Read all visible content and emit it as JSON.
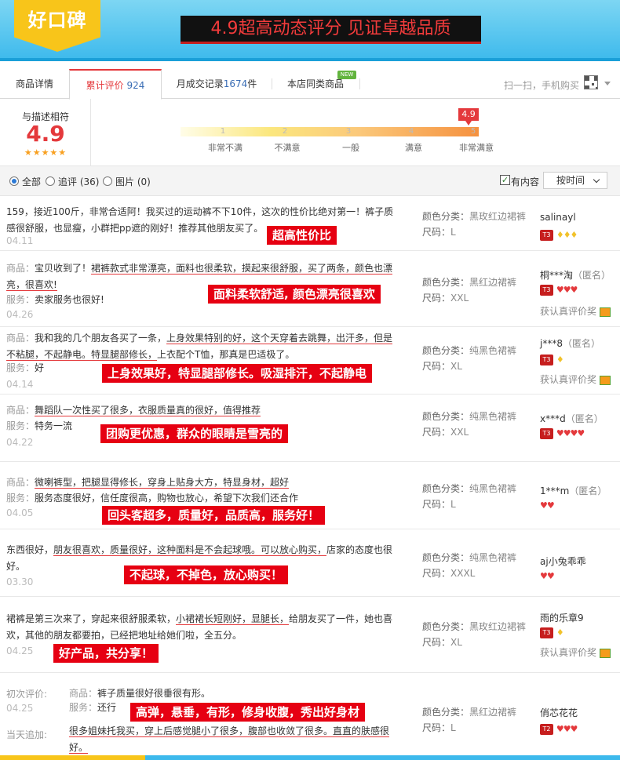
{
  "banner": {
    "logo": "好口碑",
    "slogan": "4.9超高动态评分  见证卓越品质"
  },
  "tabs": [
    {
      "label": "商品详情",
      "num": ""
    },
    {
      "label": "累计评价 ",
      "num": "924"
    },
    {
      "label": "月成交记录",
      "num": "1674",
      "suffix": "件"
    },
    {
      "label": "本店同类商品",
      "num": ""
    }
  ],
  "new_badge": "NEW",
  "scan_text": "扫一扫，手机购买",
  "rating": {
    "caption": "与描述相符",
    "score": "4.9",
    "stars": "★★★★★",
    "pointer": "4.9",
    "scale": [
      "1",
      "2",
      "3",
      "4",
      "5"
    ],
    "labels": [
      "非常不满",
      "不满意",
      "一般",
      "满意",
      "非常满意"
    ]
  },
  "filters": {
    "all": "全部",
    "followup": "追评 (36)",
    "photos": "图片 (0)",
    "has_content": "有内容",
    "sort": "按时间"
  },
  "reviews": [
    {
      "text_a": "159，接近100斤，非常合适阿！我买过的运动裤不下10件，这次的性价比绝对第一！裤子质感很舒服，也显瘦，小群把pp遮的刚好！推荐其他朋友买了。",
      "date": "04.11",
      "tag": "超高性价比",
      "color_label": "颜色分类：",
      "color": "黑玫红边裙裤",
      "size_label": "尺码：",
      "size": "L",
      "user": "salinayl",
      "level": "T3",
      "reward": ""
    },
    {
      "prefix": "商品：",
      "text_a": "宝贝收到了！",
      "text_u": "裙裤款式非常漂亮，面料也很柔软，摸起来很舒服，买了两条，颜色也漂亮，很喜欢!",
      "service_label": "服务：",
      "service": "卖家服务也很好!",
      "date": "04.26",
      "tag": "面料柔软舒适, 颜色漂亮很喜欢",
      "color_label": "颜色分类：",
      "color": "黑红边裙裤",
      "size_label": "尺码：",
      "size": "XXL",
      "user": "桐***淘",
      "anon": "（匿名）",
      "level": "T3",
      "reward": "获认真评价奖"
    },
    {
      "prefix": "商品：",
      "text_a": "我和我的几个朋友各买了一条，",
      "text_u": "上身效果特别的好，这个天穿着去跳舞，出汗多，但是不粘腿，不起静电。特显腿部修长，",
      "text_b": "上衣配个T恤，那真是巴适极了。",
      "service_label": "服务：",
      "service": "好",
      "date": "04.14",
      "tag": "上身效果好，特显腿部修长。吸湿排汗，不起静电",
      "color_label": "颜色分类：",
      "color": "纯黑色裙裤",
      "size_label": "尺码：",
      "size": "XL",
      "user": "j***8",
      "anon": "（匿名）",
      "level": "T3",
      "reward": "获认真评价奖"
    },
    {
      "prefix": "商品：",
      "text_u": "舞蹈队一次性买了很多，衣服质量真的很好，值得推荐",
      "service_label": "服务：",
      "service": "特务一流",
      "date": "04.22",
      "tag": "团购更优惠，群众的眼睛是雪亮的",
      "color_label": "颜色分类：",
      "color": "纯黑色裙裤",
      "size_label": "尺码：",
      "size": "XXL",
      "user": "x***d",
      "anon": "（匿名）",
      "level": "T3",
      "reward": ""
    },
    {
      "prefix": "商品：",
      "text_u": "微喇裤型，把腿显得修长，穿身上贴身大方，特显身材，超好",
      "service_label": "服务：",
      "service": "服务态度很好，信任度很高，购物也放心，希望下次我们还合作",
      "date": "04.05",
      "tag": "回头客超多，质量好，品质高，服务好！",
      "color_label": "颜色分类：",
      "color": "纯黑色裙裤",
      "size_label": "尺码：",
      "size": "L",
      "user": "1***m",
      "anon": "（匿名）",
      "level": "",
      "reward": ""
    },
    {
      "text_a": "东西很好，",
      "text_u": "朋友很喜欢，质量很好，这种面料是不会起球哦。可以放心购买，",
      "text_b": "店家的态度也很好。",
      "date": "03.30",
      "tag": "不起球，不掉色，放心购买！",
      "color_label": "颜色分类：",
      "color": "纯黑色裙裤",
      "size_label": "尺码：",
      "size": "XXXL",
      "user": "aj小兔乖乖",
      "level": "",
      "reward": ""
    },
    {
      "text_a": "裙裤是第三次来了，穿起来很舒服柔软，",
      "text_u": "小裙裙长短刚好，显腿长，",
      "text_b": "给朋友买了一件，她也喜欢，其他的朋友都要拍，已经把地址给她们啦，全五分。",
      "date": "04.25",
      "tag": "好产品，共分享！",
      "color_label": "颜色分类：",
      "color": "黑玫红边裙裤",
      "size_label": "尺码：",
      "size": "XL",
      "user": "雨的乐章9",
      "level": "T3",
      "reward": "获认真评价奖"
    },
    {
      "first_label": "初次评价:",
      "prefix": "商品：",
      "text_a": "裤子质量很好很垂很有形。",
      "service_label": "服务：",
      "service": "还行",
      "date": "04.25",
      "append_label": "当天追加:",
      "append_u": "很多姐妹托我买，穿上后感觉腿小了很多，腹部也收敛了很多。直直的肤感很好。",
      "tag": "高弹，悬垂，有形，修身收腹，秀出好身材",
      "color_label": "颜色分类：",
      "color": "黑红边裙裤",
      "size_label": "尺码：",
      "size": "L",
      "user": "俏芯花花",
      "level": "T2",
      "reward": ""
    }
  ]
}
